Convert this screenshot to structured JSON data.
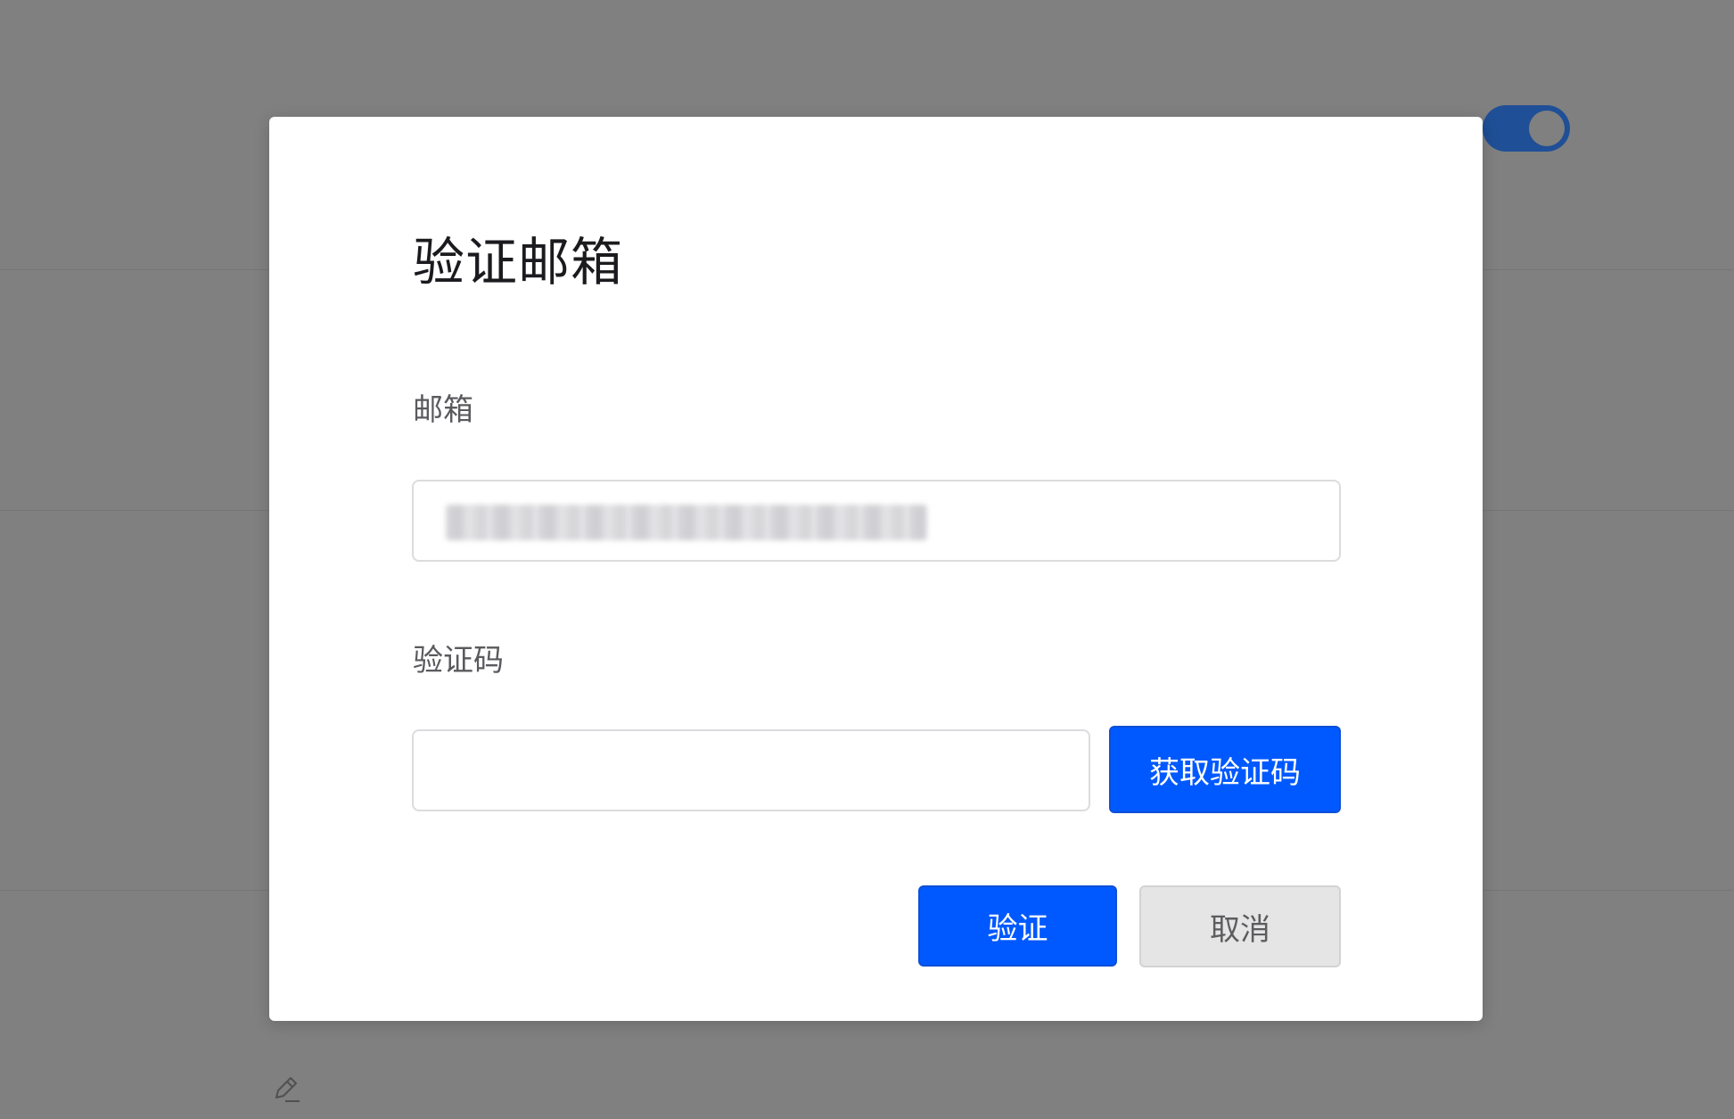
{
  "background": {
    "toggle_state": "on",
    "edit_icon": "pencil-icon"
  },
  "dialog": {
    "title": "验证邮箱",
    "email_label": "邮箱",
    "email_value_note": "redacted",
    "code_label": "验证码",
    "code_value": "",
    "get_code_button": "获取验证码",
    "verify_button": "验证",
    "cancel_button": "取消"
  },
  "colors": {
    "primary": "#0059ff",
    "overlay": "#808080",
    "cancel_bg": "#e5e5e5"
  }
}
